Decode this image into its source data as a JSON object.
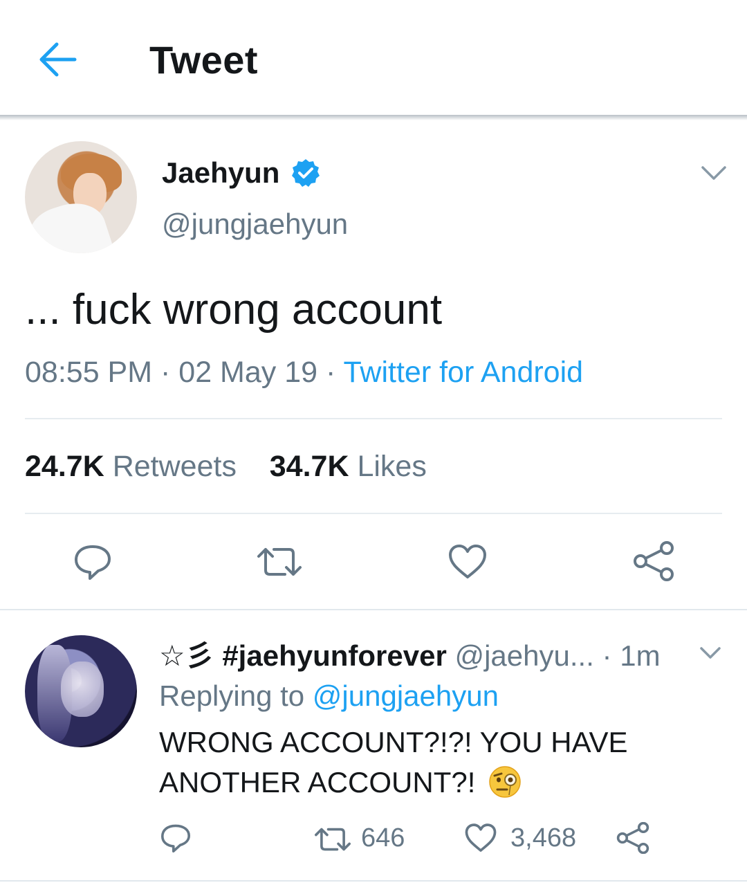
{
  "header": {
    "title": "Tweet",
    "back_icon": "arrow-left-icon",
    "accent": "#1da1f2"
  },
  "tweet": {
    "name": "Jaehyun",
    "handle": "@jungjaehyun",
    "verified": true,
    "text": "... fuck wrong account",
    "time": "08:55 PM",
    "date": "02 May 19",
    "separator": " · ",
    "source": "Twitter for Android",
    "retweets_count": "24.7K",
    "retweets_label": "Retweets",
    "likes_count": "34.7K",
    "likes_label": "Likes",
    "actions": [
      "reply-icon",
      "retweet-icon",
      "like-icon",
      "share-icon"
    ]
  },
  "reply": {
    "name": "☆彡 #jaehyunforever",
    "handle": "@jaehyu...",
    "time_sep": " · ",
    "time": "1m",
    "replying_prefix": "Replying to ",
    "replying_to": "@jungjaehyun",
    "text_line1": "WRONG ACCOUNT?!?! YOU HAVE",
    "text_line2": "ANOTHER ACCOUNT?! ",
    "emoji": "face-with-monocle",
    "retweet_count": "646",
    "like_count": "3,468"
  },
  "colors": {
    "text": "#14171a",
    "secondary": "#657786",
    "link": "#1da1f2",
    "divider": "#e6ecf0"
  }
}
